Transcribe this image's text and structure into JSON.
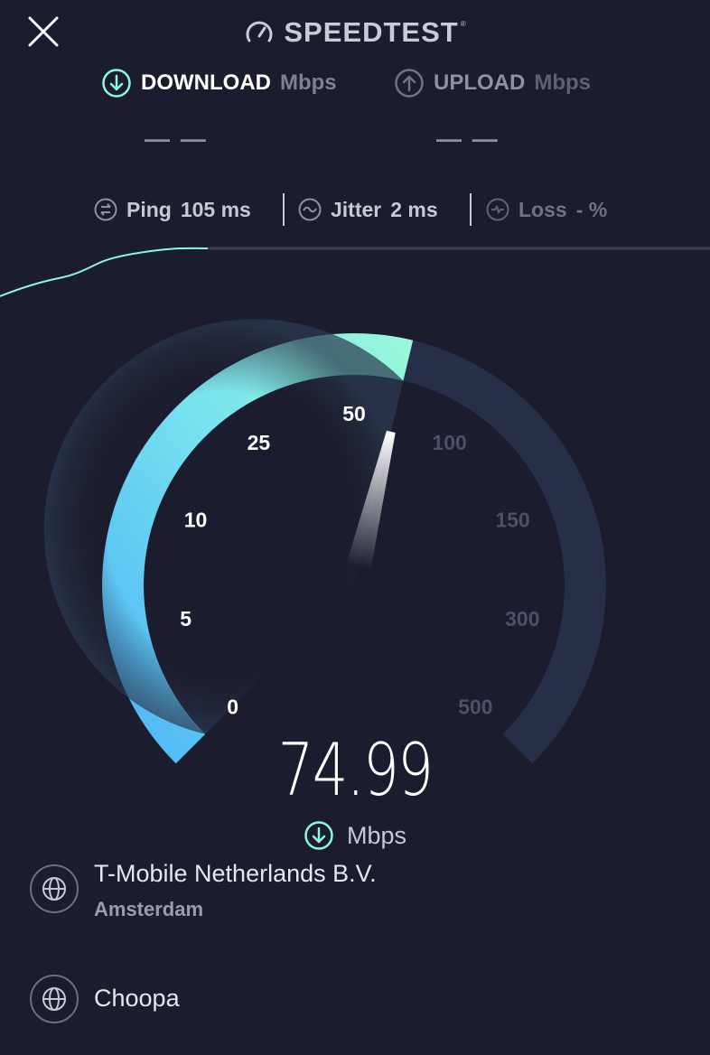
{
  "header": {
    "brand": "SPEEDTEST",
    "trademark": "®",
    "icons": {
      "close": "close-icon",
      "logo": "speedometer-icon"
    }
  },
  "download": {
    "label": "DOWNLOAD",
    "unit": "Mbps",
    "value": "— —",
    "icon": "download-arrow-icon"
  },
  "upload": {
    "label": "UPLOAD",
    "unit": "Mbps",
    "value": "— —",
    "icon": "upload-arrow-icon"
  },
  "stats": {
    "ping": {
      "label": "Ping",
      "value": "105 ms",
      "icon": "ping-icon"
    },
    "jitter": {
      "label": "Jitter",
      "value": "2 ms",
      "icon": "jitter-icon"
    },
    "loss": {
      "label": "Loss",
      "value": "- %",
      "icon": "loss-icon"
    }
  },
  "gauge": {
    "ticks": [
      "0",
      "5",
      "10",
      "25",
      "50",
      "100",
      "150",
      "300",
      "500"
    ],
    "current_speed": "74.99",
    "unit": "Mbps",
    "fill_fraction": 0.55,
    "colors": {
      "fill_start": "#4fb5f6",
      "fill_end": "#8ef7da",
      "track": "#272e48",
      "needle": "#ffffff"
    }
  },
  "servers": [
    {
      "name": "T-Mobile Netherlands B.V.",
      "location": "Amsterdam",
      "icon": "globe-icon"
    },
    {
      "name": "Choopa",
      "icon": "globe-icon"
    }
  ],
  "colors": {
    "background": "#1b1d2e",
    "accent": "#8ef7da",
    "text_dim": "#7d8194"
  }
}
